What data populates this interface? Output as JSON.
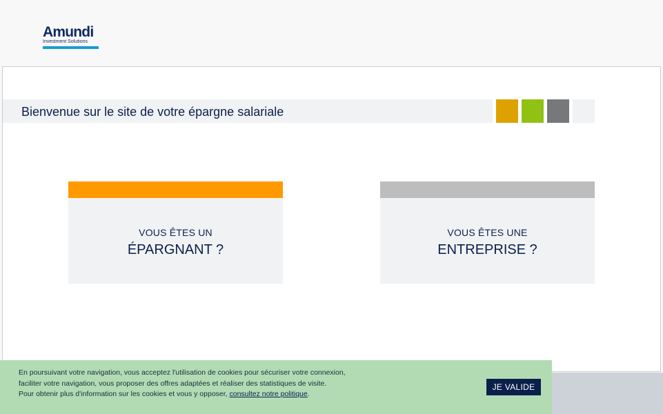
{
  "brand": {
    "logo_word": "Amundi",
    "logo_subtitle": "Investment Solutions",
    "logo_color": "#0c2a5f",
    "logo_bar_color": "#1a9ad6"
  },
  "welcome": {
    "title": "Bienvenue sur le site de votre épargne salariale",
    "square_colors": [
      "#dda200",
      "#91c113",
      "#76787b"
    ]
  },
  "cards": [
    {
      "line1": "VOUS ÊTES UN",
      "line2": "ÉPARGNANT ?",
      "accent_color": "#ff9900"
    },
    {
      "line1": "VOUS ÊTES UNE",
      "line2": "ENTREPRISE ?",
      "accent_color": "#bdbdbd"
    }
  ],
  "cookie_banner": {
    "line1": "En poursuivant votre navigation, vous acceptez l'utilisation de cookies pour sécuriser votre connexion,",
    "line2": "faciliter votre navigation, vous proposer des offres adaptées et réaliser des statistiques de visite.",
    "line3_prefix": "Pour obtenir plus d'information sur les cookies et vous y opposer, ",
    "link_label": "consultez notre politique",
    "line3_suffix": ".",
    "accept_label": "JE VALIDE",
    "background_color": "#b2dbb4"
  },
  "colors": {
    "navy": "#0b1f4b",
    "panel_gray": "#f1f2f4"
  }
}
